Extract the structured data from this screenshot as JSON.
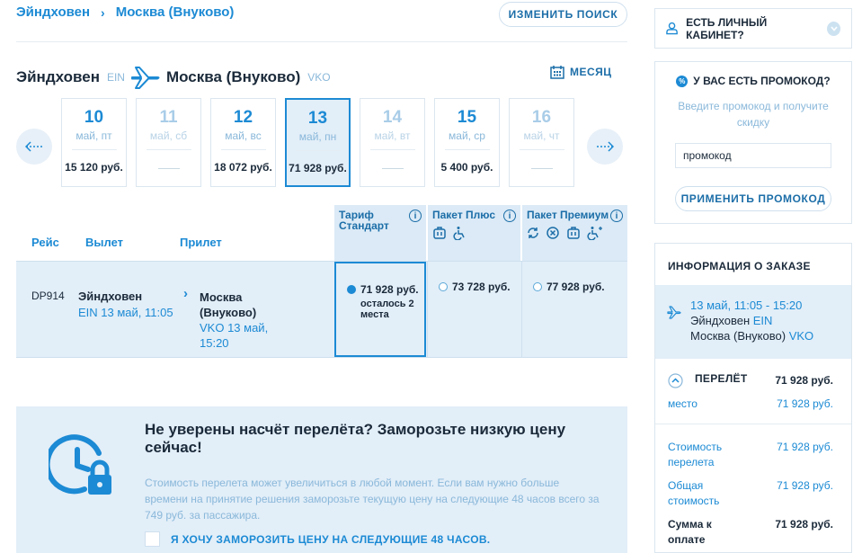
{
  "breadcrumb": {
    "from": "Эйндховен",
    "sep": "›",
    "to": "Москва (Внуково)"
  },
  "change_search": "ИЗМЕНИТЬ ПОИСК",
  "route": {
    "from": "Эйндховен",
    "from_code": "EIN",
    "to": "Москва (Внуково)",
    "to_code": "VKO"
  },
  "month_label": "МЕСЯЦ",
  "days": [
    {
      "num": "10",
      "dw": "май, пт",
      "price": "15 120 руб.",
      "available": true,
      "selected": false
    },
    {
      "num": "11",
      "dw": "май, сб",
      "price": "",
      "available": false,
      "selected": false
    },
    {
      "num": "12",
      "dw": "май, вс",
      "price": "18 072 руб.",
      "available": true,
      "selected": false
    },
    {
      "num": "13",
      "dw": "май, пн",
      "price": "71 928 руб.",
      "available": true,
      "selected": true
    },
    {
      "num": "14",
      "dw": "май, вт",
      "price": "",
      "available": false,
      "selected": false
    },
    {
      "num": "15",
      "dw": "май, ср",
      "price": "5 400 руб.",
      "available": true,
      "selected": false
    },
    {
      "num": "16",
      "dw": "май, чт",
      "price": "",
      "available": false,
      "selected": false
    }
  ],
  "table": {
    "col_flight": "Рейс",
    "col_depart": "Вылет",
    "col_arrive": "Прилет",
    "tariffs": [
      {
        "name": "Тариф Стандарт",
        "info": "i"
      },
      {
        "name": "Пакет Плюс",
        "info": "i"
      },
      {
        "name": "Пакет Премиум",
        "info": "i"
      }
    ]
  },
  "flight": {
    "number": "DP914",
    "dep_city": "Эйндховен",
    "dep_detail": "EIN 13 май, 11:05",
    "arr_city": "Москва (Внуково)",
    "arr_detail": "VKO 13 май, 15:20",
    "arrow": "›",
    "fares": [
      {
        "price": "71 928 руб.",
        "note": "осталось 2 места"
      },
      {
        "price": "73 728 руб.",
        "note": ""
      },
      {
        "price": "77 928 руб.",
        "note": ""
      }
    ]
  },
  "freeze": {
    "title": "Не уверены насчёт перелёта? Заморозьте низкую цену сейчас!",
    "text": "Стоимость перелета может увеличиться в любой момент. Если вам нужно больше времени на принятие решения заморозьте текущую цену на следующие 48 часов всего за 749 руб. за пассажира.",
    "checkbox": "Я ХОЧУ ЗАМОРОЗИТЬ ЦЕНУ НА СЛЕДУЮЩИЕ 48 ЧАСОВ."
  },
  "cabinet": {
    "label": "ЕСТЬ ЛИЧНЫЙ КАБИНЕТ?"
  },
  "promo": {
    "title": "У ВАС ЕСТЬ ПРОМОКОД?",
    "badge": "%",
    "desc": "Введите промокод и получите скидку",
    "input_value": "промокод",
    "apply": "ПРИМЕНИТЬ ПРОМОКОД"
  },
  "order": {
    "title": "ИНФОРМАЦИЯ О ЗАКАЗЕ",
    "seg_time": "13 май, 11:05 - 15:20",
    "seg_from": "Эйндховен",
    "seg_from_code": "EIN",
    "seg_to": "Москва (Внуково)",
    "seg_to_code": "VKO",
    "flight_label": "ПЕРЕЛЁТ",
    "flight_value": "71 928 руб.",
    "seat_label": "место",
    "seat_value": "71 928 руб.",
    "cost_label": "Стоимость перелета",
    "cost_value": "71 928 руб.",
    "total_label": "Общая стоимость",
    "total_value": "71 928 руб.",
    "pay_label": "Сумма к оплате",
    "pay_value": "71 928 руб."
  }
}
